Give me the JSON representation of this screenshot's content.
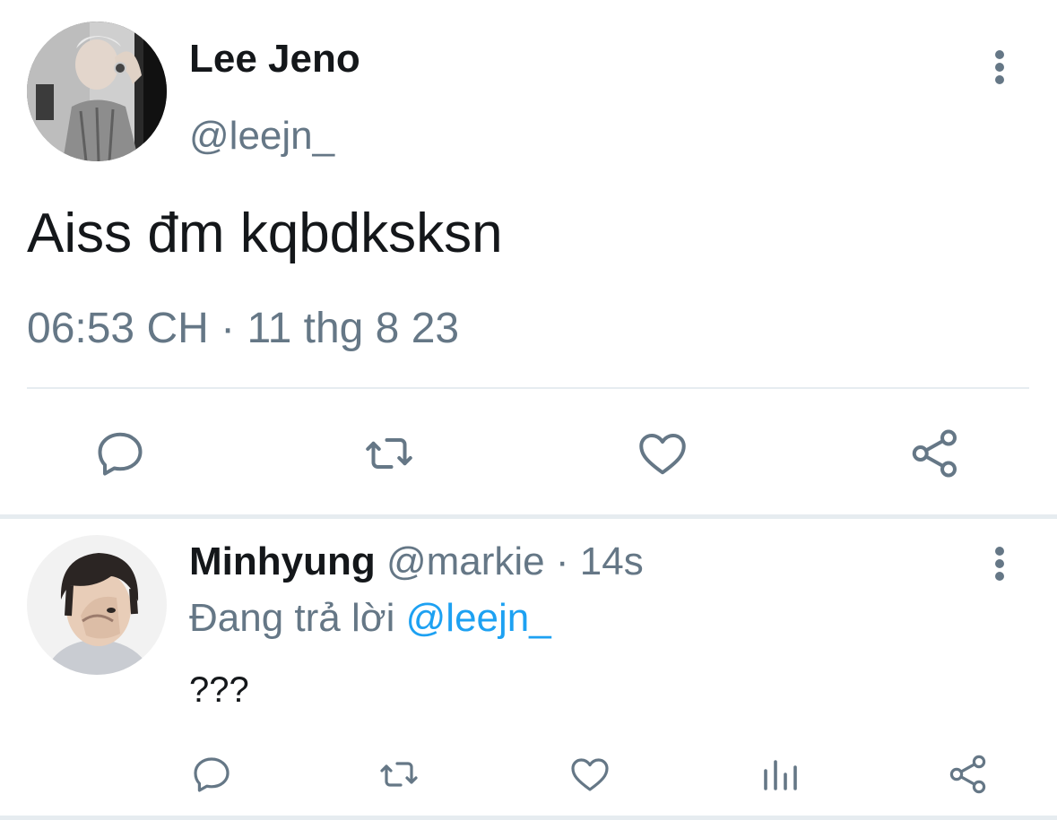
{
  "main_tweet": {
    "author_name": "Lee Jeno",
    "author_handle": "@leejn_",
    "text": "Aiss đm kqbdksksn",
    "timestamp": "06:53 CH · 11 thg 8 23",
    "icons": {
      "reply": "reply-icon",
      "retweet": "retweet-icon",
      "like": "like-icon",
      "share": "share-icon",
      "more": "more-vertical-icon"
    }
  },
  "reply_tweet": {
    "author_name": "Minhyung",
    "author_handle": "@markie",
    "separator": " · ",
    "age": "14s",
    "replying_to_label": "Đang trả lời",
    "replying_to_handle": "@leejn_",
    "text": "???",
    "icons": {
      "reply": "reply-icon",
      "retweet": "retweet-icon",
      "like": "like-icon",
      "analytics": "analytics-icon",
      "share": "share-icon",
      "more": "more-vertical-icon"
    }
  },
  "colors": {
    "primary_text": "#14171a",
    "secondary_text": "#657786",
    "link": "#1da1f2",
    "divider": "#e6ecf0"
  }
}
